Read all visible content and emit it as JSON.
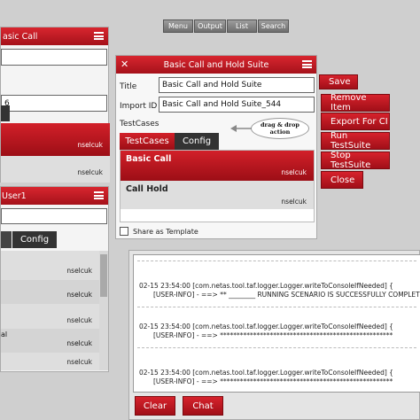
{
  "nav": {
    "menu": "Menu",
    "output": "Output",
    "list": "List",
    "search": "Search"
  },
  "left_panel_top": {
    "title_partial": "asic Call",
    "field1": "",
    "field2": "6",
    "row1_user": "nselcuk",
    "row2_user": "nselcuk"
  },
  "left_panel_bottom": {
    "title_partial": "User1",
    "config_label": "Config",
    "users": [
      "nselcuk",
      "nselcuk",
      "nselcuk",
      "nselcuk",
      "nselcuk"
    ],
    "partial_item": "al"
  },
  "suite_dialog": {
    "title": "Basic Call and Hold Suite",
    "title_label": "Title",
    "title_value": "Basic Call and Hold Suite",
    "import_label": "Import ID",
    "import_value": "Basic Call and Hold Suite_544",
    "testcases_label": "TestCases",
    "callout_line1": "drag & drop",
    "callout_line2": "action",
    "tab_testcases": "TestCases",
    "tab_config": "Config",
    "cases": [
      {
        "name": "Basic Call",
        "user": "nselcuk"
      },
      {
        "name": "Call Hold",
        "user": "nselcuk"
      }
    ],
    "template_label": "Share as Template"
  },
  "actions": {
    "save": "Save",
    "remove": "Remove Item",
    "export": "Export For CI",
    "run": "Run TestSuite",
    "stop": "Stop TestSuite",
    "close": "Close"
  },
  "console": {
    "lines": [
      {
        "ts": "02-15 23:54:00 [com.netas.tool.taf.logger.Logger.writeToConsoleIfNeeded] {",
        "msg": "[USER-INFO] -  ==> **  ________ RUNNING SCENARIO IS SUCCESSFULLY COMPLETED"
      },
      {
        "ts": "02-15 23:54:00 [com.netas.tool.taf.logger.Logger.writeToConsoleIfNeeded] {",
        "msg": "[USER-INFO] -  ==> ****************************************************"
      },
      {
        "ts": "02-15 23:54:00 [com.netas.tool.taf.logger.Logger.writeToConsoleIfNeeded] {",
        "msg": "[USER-INFO] -  ==> ****************************************************"
      }
    ],
    "clear": "Clear",
    "chat": "Chat"
  },
  "colors": {
    "accent_red": "#c41a22",
    "nav_gray": "#808080",
    "panel_bg": "#f4f4f4"
  }
}
